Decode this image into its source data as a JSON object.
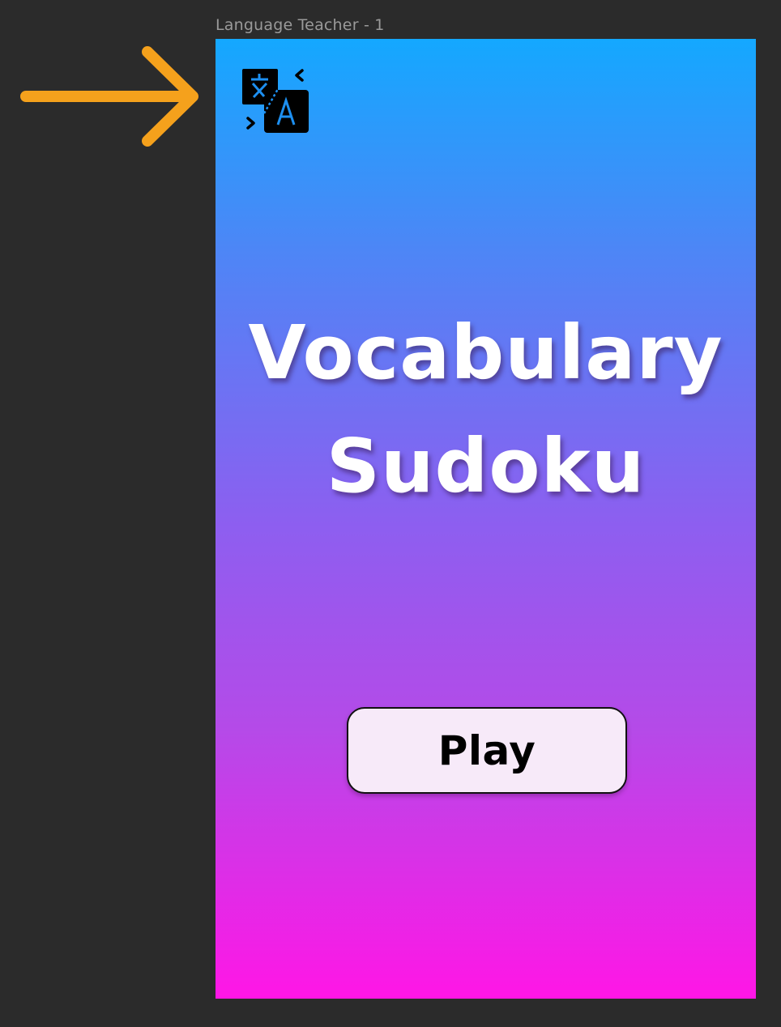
{
  "frame": {
    "label": "Language Teacher - 1"
  },
  "colors": {
    "canvas_bg": "#2b2b2b",
    "arrow": "#f5a11c",
    "gradient_top": "#14a8ff",
    "gradient_bottom": "#ff16e6",
    "button_bg": "#f7eaf9"
  },
  "icons": {
    "pointer": "arrow-right-icon",
    "app": "translate-icon"
  },
  "screen": {
    "title_line1": "Vocabulary",
    "title_line2": "Sudoku",
    "play_button_label": "Play"
  }
}
